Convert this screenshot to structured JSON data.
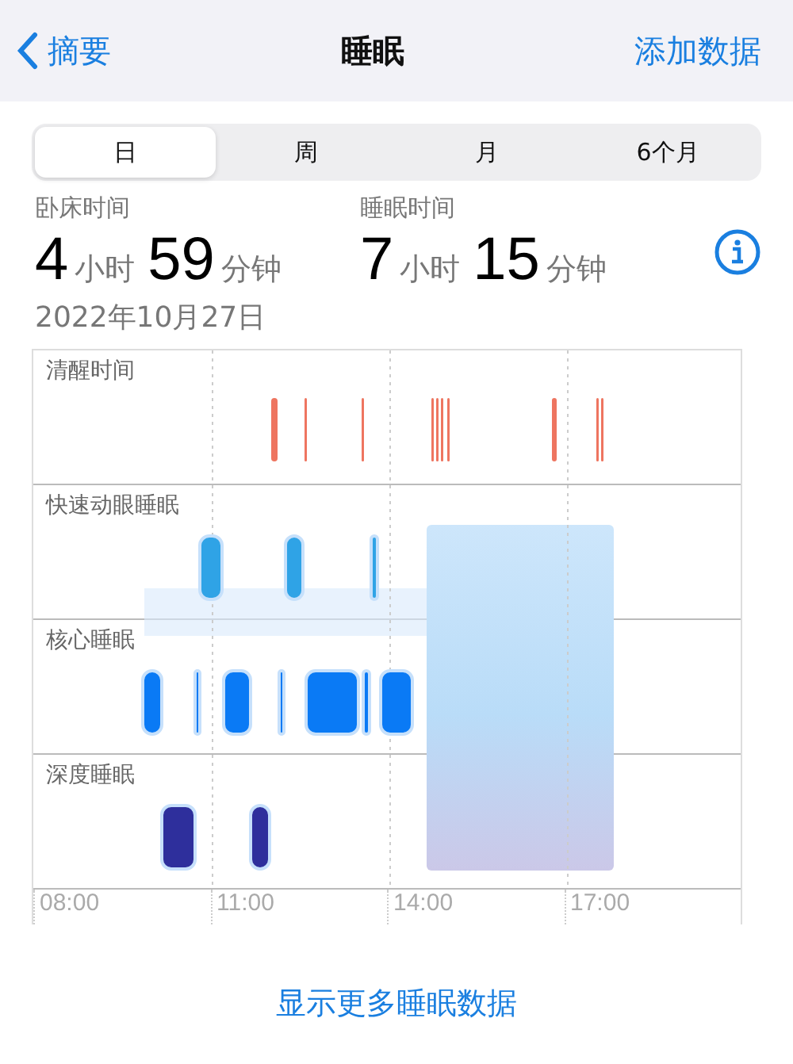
{
  "nav": {
    "back": "摘要",
    "title": "睡眠",
    "action": "添加数据"
  },
  "tabs": [
    {
      "label": "日",
      "selected": true
    },
    {
      "label": "周",
      "selected": false
    },
    {
      "label": "月",
      "selected": false
    },
    {
      "label": "6个月",
      "selected": false
    }
  ],
  "stats": [
    {
      "label": "卧床时间",
      "hours": "4",
      "hours_unit": "小时",
      "minutes": "59",
      "minutes_unit": "分钟"
    },
    {
      "label": "睡眠时间",
      "hours": "7",
      "hours_unit": "小时",
      "minutes": "15",
      "minutes_unit": "分钟"
    }
  ],
  "date": "2022年10月27日",
  "stages": [
    "清醒时间",
    "快速动眼睡眠",
    "核心睡眠",
    "深度睡眠"
  ],
  "time_ticks": [
    "08:00",
    "11:00",
    "14:00",
    "17:00"
  ],
  "more_button": "显示更多睡眠数据"
}
